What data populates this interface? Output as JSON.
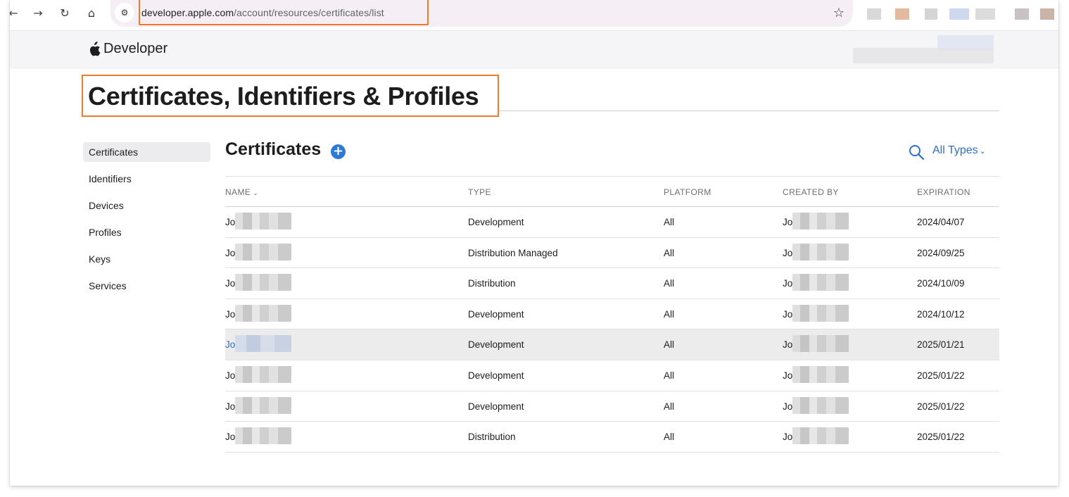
{
  "browser": {
    "url_host": "developer.apple.com",
    "url_path": "/account/resources/certificates/list"
  },
  "nav": {
    "brand": "Developer"
  },
  "page": {
    "title": "Certificates, Identifiers & Profiles"
  },
  "sidebar": {
    "items": [
      {
        "label": "Certificates",
        "active": true
      },
      {
        "label": "Identifiers"
      },
      {
        "label": "Devices"
      },
      {
        "label": "Profiles"
      },
      {
        "label": "Keys"
      },
      {
        "label": "Services"
      }
    ]
  },
  "main": {
    "section_title": "Certificates",
    "filter_label": "All Types"
  },
  "table": {
    "headers": {
      "name": "NAME",
      "type": "TYPE",
      "platform": "PLATFORM",
      "created_by": "CREATED BY",
      "expiration": "EXPIRATION"
    },
    "rows": [
      {
        "name": "Jo",
        "type": "Development",
        "platform": "All",
        "created_by": "Jo",
        "expiration": "2024/04/07"
      },
      {
        "name": "Jo",
        "type": "Distribution Managed",
        "platform": "All",
        "created_by": "Jo",
        "expiration": "2024/09/25"
      },
      {
        "name": "Jo",
        "type": "Distribution",
        "platform": "All",
        "created_by": "Jo",
        "expiration": "2024/10/09"
      },
      {
        "name": "Jo",
        "type": "Development",
        "platform": "All",
        "created_by": "Jo",
        "expiration": "2024/10/12"
      },
      {
        "name": "Jo",
        "type": "Development",
        "platform": "All",
        "created_by": "Jo",
        "expiration": "2025/01/21"
      },
      {
        "name": "Jo",
        "type": "Development",
        "platform": "All",
        "created_by": "Jo",
        "expiration": "2025/01/22"
      },
      {
        "name": "Jo",
        "type": "Development",
        "platform": "All",
        "created_by": "Jo",
        "expiration": "2025/01/22"
      },
      {
        "name": "Jo",
        "type": "Distribution",
        "platform": "All",
        "created_by": "Jo",
        "expiration": "2025/01/22"
      }
    ]
  },
  "colors": {
    "accent": "#2d6fc4",
    "highlight_box": "#f07a2c",
    "selected_row": "#ececec"
  }
}
